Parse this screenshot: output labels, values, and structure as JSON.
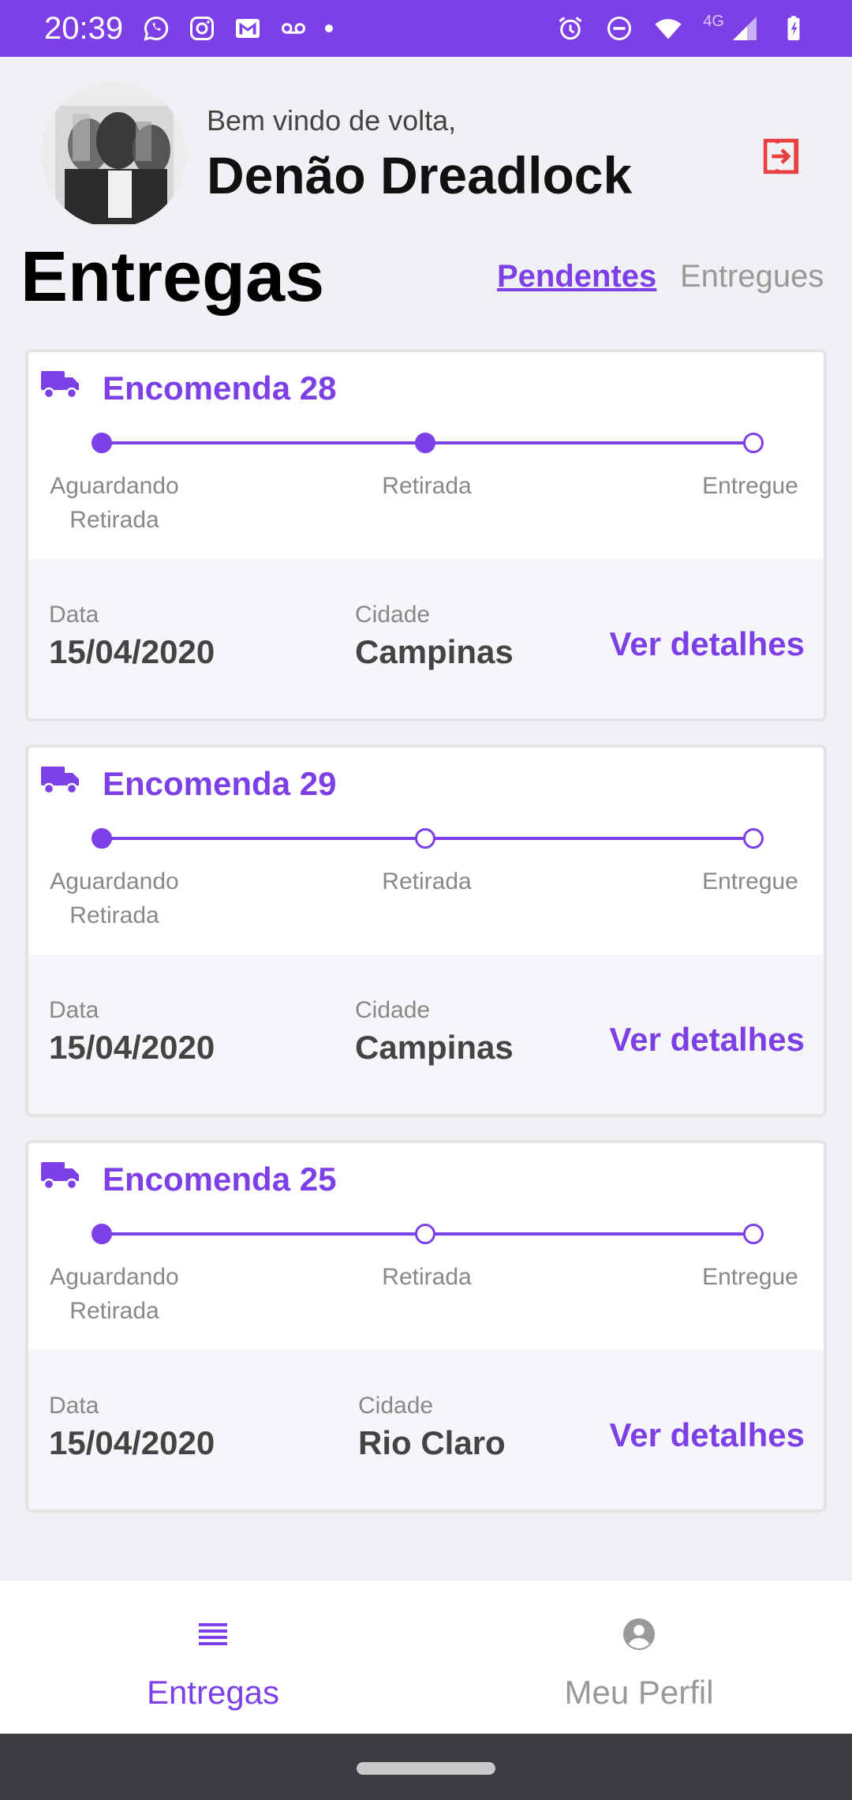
{
  "status_bar": {
    "time": "20:39",
    "network": "4G",
    "left_icons": [
      "whatsapp-icon",
      "instagram-icon",
      "gmail-icon",
      "voicemail-icon",
      "dot-icon"
    ],
    "right_icons": [
      "alarm-icon",
      "dnd-icon",
      "wifi-icon",
      "signal-icon",
      "battery-icon"
    ]
  },
  "header": {
    "welcome": "Bem vindo de volta,",
    "user_name": "Denão Dreadlock",
    "logout_icon": "logout-icon"
  },
  "page": {
    "title": "Entregas",
    "filters": {
      "pending": "Pendentes",
      "delivered": "Entregues",
      "active": "pending"
    }
  },
  "orders": [
    {
      "title": "Encomenda 28",
      "steps": [
        "Aguardando",
        "Retirada",
        "Retirada",
        "Entregue"
      ],
      "progress_step": 2,
      "date_label": "Data",
      "date": "15/04/2020",
      "city_label": "Cidade",
      "city": "Campinas",
      "action": "Ver detalhes"
    },
    {
      "title": "Encomenda 29",
      "steps": [
        "Aguardando",
        "Retirada",
        "Retirada",
        "Entregue"
      ],
      "progress_step": 1,
      "date_label": "Data",
      "date": "15/04/2020",
      "city_label": "Cidade",
      "city": "Campinas",
      "action": "Ver detalhes"
    },
    {
      "title": "Encomenda 25",
      "steps": [
        "Aguardando",
        "Retirada",
        "Retirada",
        "Entregue"
      ],
      "progress_step": 1,
      "date_label": "Data",
      "date": "15/04/2020",
      "city_label": "Cidade",
      "city": "Rio Claro",
      "action": "Ver detalhes"
    }
  ],
  "bottom_nav": {
    "items": [
      {
        "label": "Entregas",
        "icon": "list-icon",
        "active": true
      },
      {
        "label": "Meu Perfil",
        "icon": "account-circle-icon",
        "active": false
      }
    ]
  },
  "colors": {
    "primary": "#7d40e7",
    "logout": "#e74040",
    "background": "#f0f0f5"
  }
}
